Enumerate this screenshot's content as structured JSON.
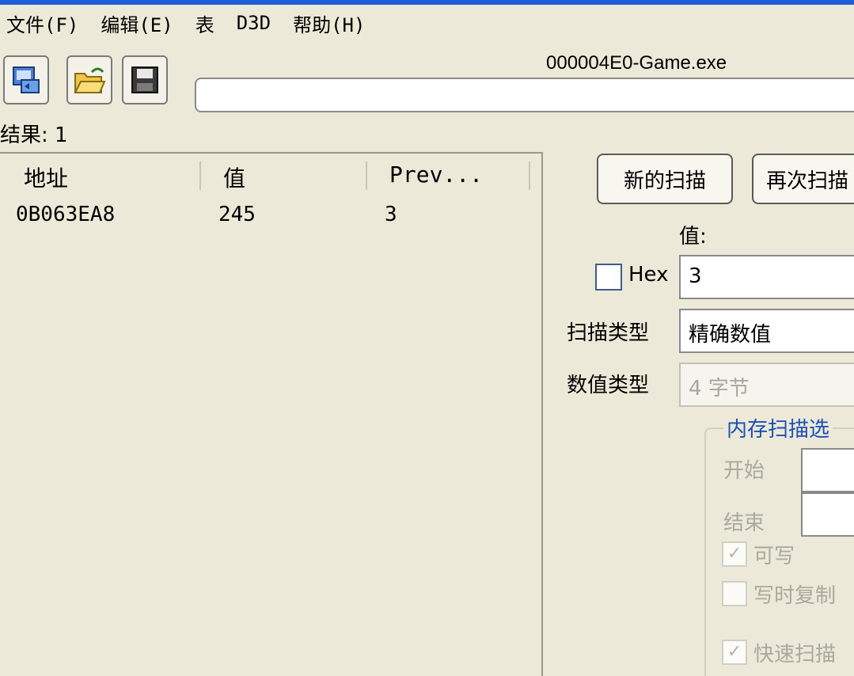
{
  "menu": {
    "items": [
      "文件(F)",
      "编辑(E)",
      "表",
      "D3D",
      "帮助(H)"
    ]
  },
  "toolbar": {
    "icons": [
      "process-select-icon",
      "open-folder-icon",
      "save-disk-icon"
    ]
  },
  "process": {
    "title": "000004E0-Game.exe"
  },
  "results": {
    "label": "结果: 1"
  },
  "list": {
    "headers": [
      "地址",
      "值",
      "Prev..."
    ],
    "rows": [
      {
        "address": "0B063EA8",
        "value": "245",
        "prev": "3"
      }
    ]
  },
  "scan": {
    "new_scan_label": "新的扫描",
    "next_scan_label": "再次扫描",
    "value_label": "值:",
    "hex_label": "Hex",
    "value_input": "3",
    "scan_type_label": "扫描类型",
    "scan_type_value": "精确数值",
    "value_type_label": "数值类型",
    "value_type_value": "4 字节"
  },
  "memory_options": {
    "title": "内存扫描选",
    "start_label": "开始",
    "end_label": "结束",
    "writable_label": "可写",
    "copy_on_write_label": "写时复制",
    "fast_scan_label": "快速扫描"
  }
}
